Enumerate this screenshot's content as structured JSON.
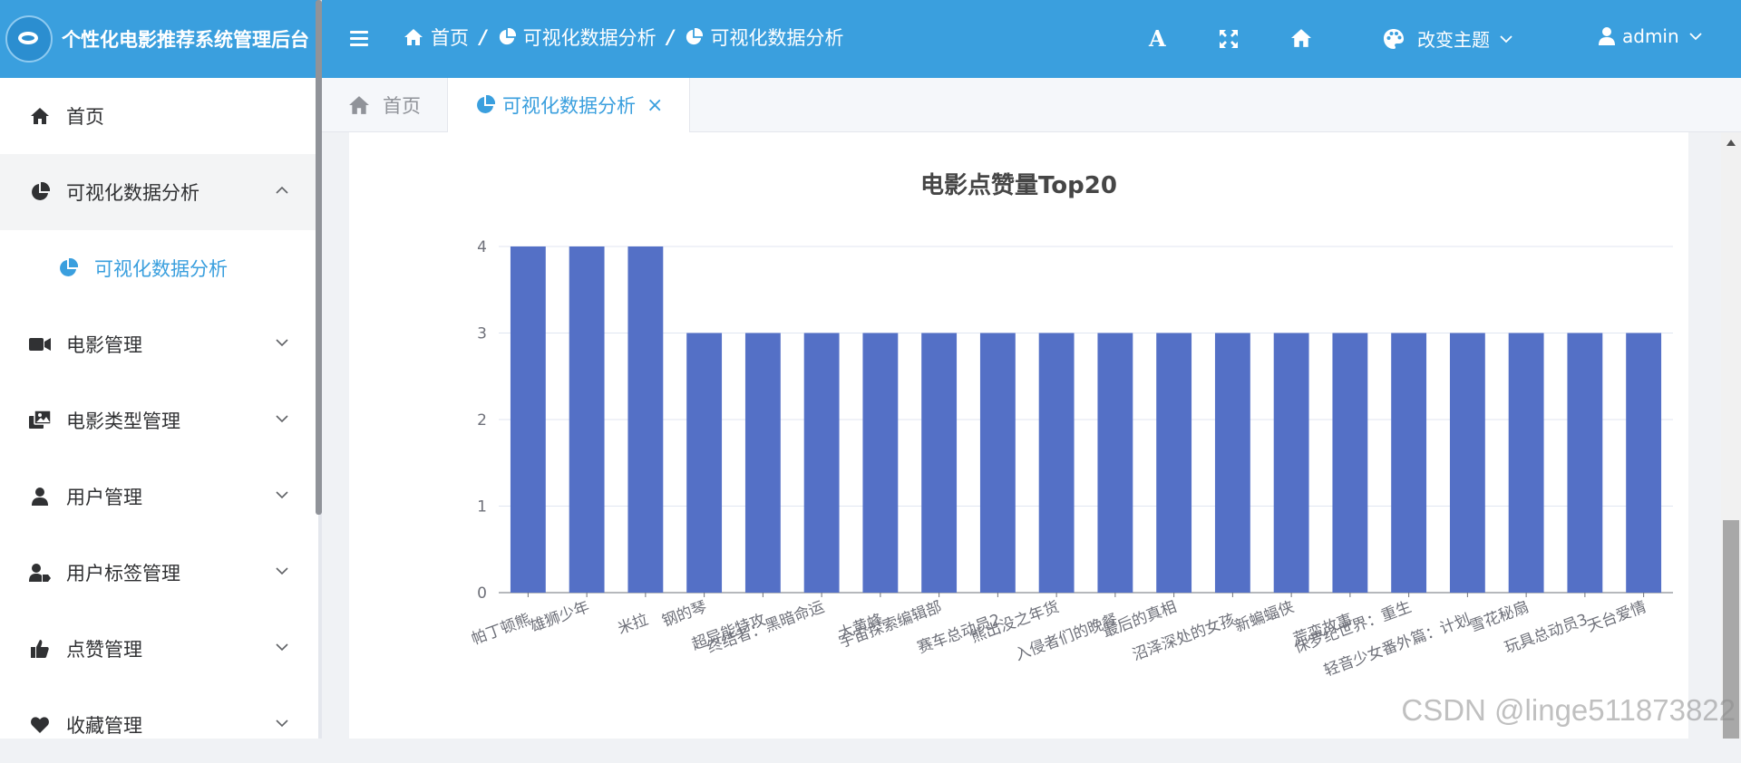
{
  "brand": {
    "title": "个性化电影推荐系统管理后台"
  },
  "sidebar": {
    "items": [
      {
        "label": "首页",
        "icon": "home-icon",
        "expanded": false
      },
      {
        "label": "可视化数据分析",
        "icon": "pie-chart-icon",
        "expanded": true,
        "children": [
          {
            "label": "可视化数据分析",
            "icon": "pie-chart-icon",
            "active": true
          }
        ]
      },
      {
        "label": "电影管理",
        "icon": "video-camera-icon"
      },
      {
        "label": "电影类型管理",
        "icon": "images-icon"
      },
      {
        "label": "用户管理",
        "icon": "user-icon"
      },
      {
        "label": "用户标签管理",
        "icon": "user-tag-icon"
      },
      {
        "label": "点赞管理",
        "icon": "thumbs-up-icon"
      },
      {
        "label": "收藏管理",
        "icon": "heart-icon"
      }
    ]
  },
  "header": {
    "breadcrumb": [
      {
        "label": "首页",
        "icon": "home-icon"
      },
      {
        "label": "可视化数据分析",
        "icon": "pie-chart-icon"
      },
      {
        "label": "可视化数据分析",
        "icon": "pie-chart-icon"
      }
    ],
    "font_button": "A",
    "theme_label": "改变主题",
    "user_label": "admin"
  },
  "tabs": [
    {
      "label": "首页",
      "active": false
    },
    {
      "label": "可视化数据分析",
      "active": true,
      "close": "×"
    }
  ],
  "watermark": "CSDN @linge511873822",
  "colors": {
    "primary": "#3a9fde",
    "bar": "#5470c6"
  },
  "chart_data": {
    "type": "bar",
    "title": "电影点赞量Top20",
    "categories": [
      "帕丁顿熊",
      "雄狮少年",
      "米拉",
      "钢的琴",
      "超异能特攻",
      "终结者：黑暗命运",
      "大黄蜂",
      "宇宙探索编辑部",
      "赛车总动员2",
      "熊出没之年货",
      "入侵者们的晚餐",
      "最后的真相",
      "沼泽深处的女孩",
      "新蝙蝠侠",
      "荒蛮故事",
      "侏罗纪世界：重生",
      "轻音少女番外篇：计划",
      "雪花秘扇",
      "玩具总动员3",
      "天台爱情"
    ],
    "values": [
      4,
      4,
      4,
      3,
      3,
      3,
      3,
      3,
      3,
      3,
      3,
      3,
      3,
      3,
      3,
      3,
      3,
      3,
      3,
      3
    ],
    "ylim": [
      0,
      4
    ],
    "yticks": [
      0,
      1,
      2,
      3,
      4
    ],
    "grid": true,
    "xlabel": "",
    "ylabel": ""
  }
}
